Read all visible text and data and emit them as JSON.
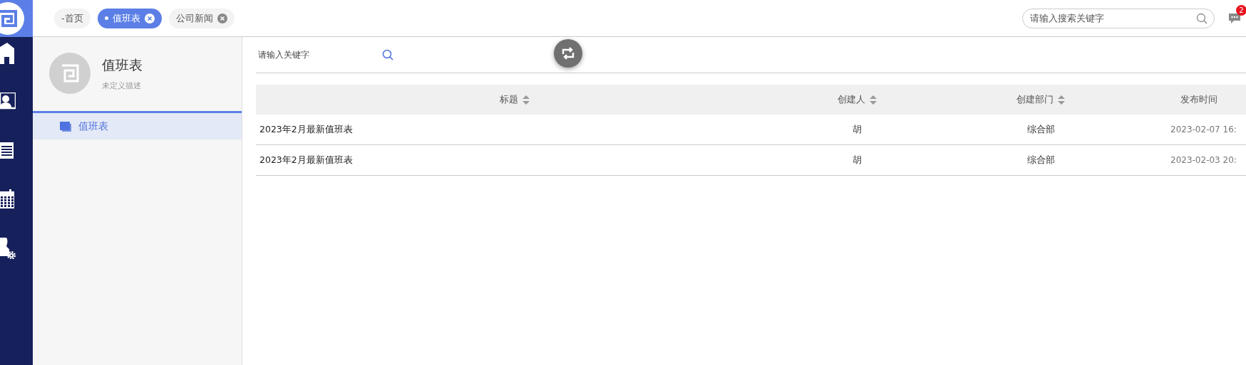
{
  "tabs": [
    {
      "label": "-首页",
      "selected": false,
      "closable": false
    },
    {
      "label": "值班表",
      "selected": true,
      "closable": true
    },
    {
      "label": "公司新闻",
      "selected": false,
      "closable": true
    }
  ],
  "search": {
    "placeholder": "请输入搜索关键字"
  },
  "notifications": {
    "badge": "2"
  },
  "module": {
    "title": "值班表",
    "description": "未定义描述"
  },
  "menu": [
    {
      "label": "值班表",
      "selected": true
    }
  ],
  "filter": {
    "placeholder": "请输入关键字"
  },
  "table": {
    "columns": [
      {
        "label": "标题",
        "sortable": true
      },
      {
        "label": "创建人",
        "sortable": true
      },
      {
        "label": "创建部门",
        "sortable": true
      },
      {
        "label": "发布时间",
        "sortable": false
      }
    ],
    "rows": [
      [
        "2023年2月最新值班表",
        "胡",
        "综合部",
        "2023-02-07 16:"
      ],
      [
        "2023年2月最新值班表",
        "胡",
        "综合部",
        "2023-02-03 20:"
      ]
    ]
  }
}
